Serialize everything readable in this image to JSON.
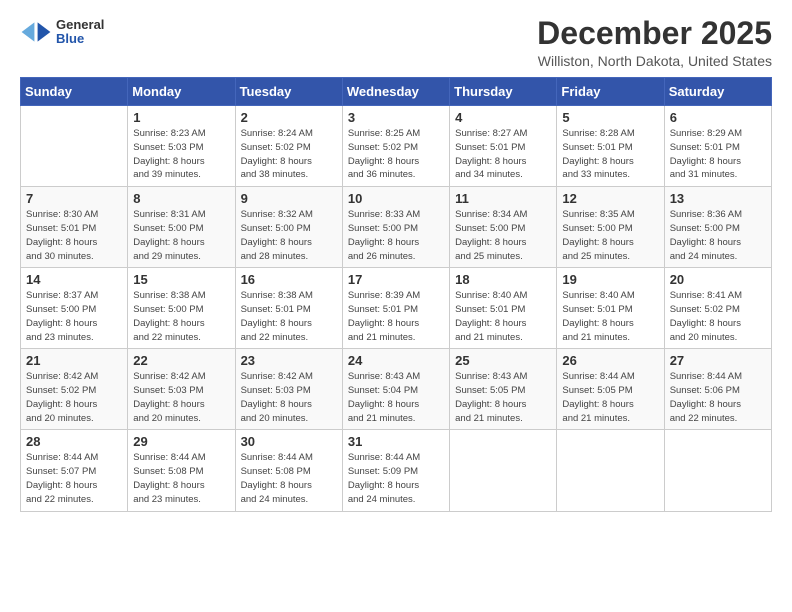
{
  "header": {
    "logo_general": "General",
    "logo_blue": "Blue",
    "month_title": "December 2025",
    "location": "Williston, North Dakota, United States"
  },
  "weekdays": [
    "Sunday",
    "Monday",
    "Tuesday",
    "Wednesday",
    "Thursday",
    "Friday",
    "Saturday"
  ],
  "weeks": [
    [
      {
        "day": "",
        "info": ""
      },
      {
        "day": "1",
        "info": "Sunrise: 8:23 AM\nSunset: 5:03 PM\nDaylight: 8 hours\nand 39 minutes."
      },
      {
        "day": "2",
        "info": "Sunrise: 8:24 AM\nSunset: 5:02 PM\nDaylight: 8 hours\nand 38 minutes."
      },
      {
        "day": "3",
        "info": "Sunrise: 8:25 AM\nSunset: 5:02 PM\nDaylight: 8 hours\nand 36 minutes."
      },
      {
        "day": "4",
        "info": "Sunrise: 8:27 AM\nSunset: 5:01 PM\nDaylight: 8 hours\nand 34 minutes."
      },
      {
        "day": "5",
        "info": "Sunrise: 8:28 AM\nSunset: 5:01 PM\nDaylight: 8 hours\nand 33 minutes."
      },
      {
        "day": "6",
        "info": "Sunrise: 8:29 AM\nSunset: 5:01 PM\nDaylight: 8 hours\nand 31 minutes."
      }
    ],
    [
      {
        "day": "7",
        "info": "Sunrise: 8:30 AM\nSunset: 5:01 PM\nDaylight: 8 hours\nand 30 minutes."
      },
      {
        "day": "8",
        "info": "Sunrise: 8:31 AM\nSunset: 5:00 PM\nDaylight: 8 hours\nand 29 minutes."
      },
      {
        "day": "9",
        "info": "Sunrise: 8:32 AM\nSunset: 5:00 PM\nDaylight: 8 hours\nand 28 minutes."
      },
      {
        "day": "10",
        "info": "Sunrise: 8:33 AM\nSunset: 5:00 PM\nDaylight: 8 hours\nand 26 minutes."
      },
      {
        "day": "11",
        "info": "Sunrise: 8:34 AM\nSunset: 5:00 PM\nDaylight: 8 hours\nand 25 minutes."
      },
      {
        "day": "12",
        "info": "Sunrise: 8:35 AM\nSunset: 5:00 PM\nDaylight: 8 hours\nand 25 minutes."
      },
      {
        "day": "13",
        "info": "Sunrise: 8:36 AM\nSunset: 5:00 PM\nDaylight: 8 hours\nand 24 minutes."
      }
    ],
    [
      {
        "day": "14",
        "info": "Sunrise: 8:37 AM\nSunset: 5:00 PM\nDaylight: 8 hours\nand 23 minutes."
      },
      {
        "day": "15",
        "info": "Sunrise: 8:38 AM\nSunset: 5:00 PM\nDaylight: 8 hours\nand 22 minutes."
      },
      {
        "day": "16",
        "info": "Sunrise: 8:38 AM\nSunset: 5:01 PM\nDaylight: 8 hours\nand 22 minutes."
      },
      {
        "day": "17",
        "info": "Sunrise: 8:39 AM\nSunset: 5:01 PM\nDaylight: 8 hours\nand 21 minutes."
      },
      {
        "day": "18",
        "info": "Sunrise: 8:40 AM\nSunset: 5:01 PM\nDaylight: 8 hours\nand 21 minutes."
      },
      {
        "day": "19",
        "info": "Sunrise: 8:40 AM\nSunset: 5:01 PM\nDaylight: 8 hours\nand 21 minutes."
      },
      {
        "day": "20",
        "info": "Sunrise: 8:41 AM\nSunset: 5:02 PM\nDaylight: 8 hours\nand 20 minutes."
      }
    ],
    [
      {
        "day": "21",
        "info": "Sunrise: 8:42 AM\nSunset: 5:02 PM\nDaylight: 8 hours\nand 20 minutes."
      },
      {
        "day": "22",
        "info": "Sunrise: 8:42 AM\nSunset: 5:03 PM\nDaylight: 8 hours\nand 20 minutes."
      },
      {
        "day": "23",
        "info": "Sunrise: 8:42 AM\nSunset: 5:03 PM\nDaylight: 8 hours\nand 20 minutes."
      },
      {
        "day": "24",
        "info": "Sunrise: 8:43 AM\nSunset: 5:04 PM\nDaylight: 8 hours\nand 21 minutes."
      },
      {
        "day": "25",
        "info": "Sunrise: 8:43 AM\nSunset: 5:05 PM\nDaylight: 8 hours\nand 21 minutes."
      },
      {
        "day": "26",
        "info": "Sunrise: 8:44 AM\nSunset: 5:05 PM\nDaylight: 8 hours\nand 21 minutes."
      },
      {
        "day": "27",
        "info": "Sunrise: 8:44 AM\nSunset: 5:06 PM\nDaylight: 8 hours\nand 22 minutes."
      }
    ],
    [
      {
        "day": "28",
        "info": "Sunrise: 8:44 AM\nSunset: 5:07 PM\nDaylight: 8 hours\nand 22 minutes."
      },
      {
        "day": "29",
        "info": "Sunrise: 8:44 AM\nSunset: 5:08 PM\nDaylight: 8 hours\nand 23 minutes."
      },
      {
        "day": "30",
        "info": "Sunrise: 8:44 AM\nSunset: 5:08 PM\nDaylight: 8 hours\nand 24 minutes."
      },
      {
        "day": "31",
        "info": "Sunrise: 8:44 AM\nSunset: 5:09 PM\nDaylight: 8 hours\nand 24 minutes."
      },
      {
        "day": "",
        "info": ""
      },
      {
        "day": "",
        "info": ""
      },
      {
        "day": "",
        "info": ""
      }
    ]
  ]
}
